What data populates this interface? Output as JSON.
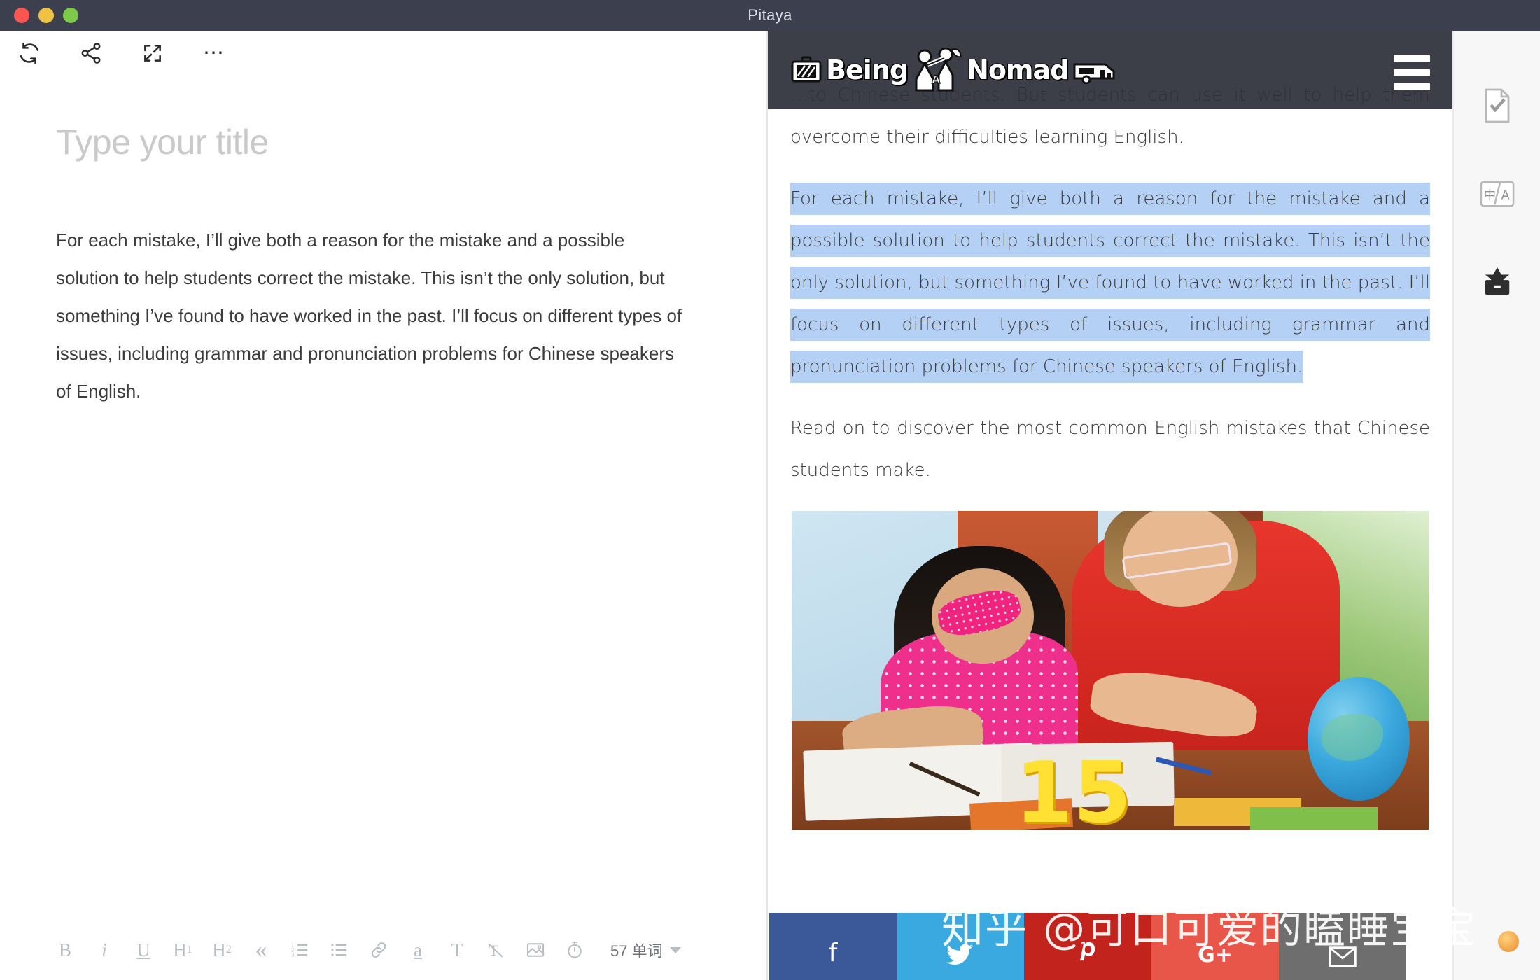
{
  "window": {
    "title": "Pitaya",
    "traffic_lights": [
      "close-red",
      "minimize-yellow",
      "zoom-green"
    ]
  },
  "editor": {
    "toolbar": [
      {
        "name": "sync-icon",
        "label": "Sync"
      },
      {
        "name": "share-icon",
        "label": "Share"
      },
      {
        "name": "fullscreen-icon",
        "label": "Fullscreen"
      },
      {
        "name": "more-options-icon",
        "label": "..."
      }
    ],
    "title_placeholder": "Type your title",
    "body_text": "For each mistake, I’ll give both a reason for the mistake and a possible solution to help students correct the mistake. This isn’t the only solution, but something I’ve found to have worked in the past. I’ll focus on different types of issues, including grammar and pronunciation problems for Chinese speakers of English."
  },
  "format_toolbar": {
    "bold": "B",
    "italic": "i",
    "underline": "U",
    "heading1": "H",
    "heading1_sub": "1",
    "heading2": "H",
    "heading2_sub": "2",
    "blockquote": "«",
    "ordered_list": "ordered-list-icon",
    "unordered_list": "unordered-list-icon",
    "link": "link-icon",
    "strikethrough": "a",
    "text_style": "T",
    "clear_format": "clear-format-icon",
    "image": "image-icon",
    "timer": "timer-icon",
    "word_count": "57 单词"
  },
  "preview": {
    "site_logo_text": "Being",
    "site_logo_text2": "Nomad",
    "site_logo_mid": "A",
    "menu_icon": "hamburger-menu-icon",
    "paragraphs": [
      {
        "id": "p-top",
        "text": "…to Chinese students. But students can use it well to help them overcome their difficulties learning English.",
        "selected": false
      },
      {
        "id": "p-selected",
        "text": "For each mistake, I’ll give both a reason for the mistake and a possible solution to help students correct the mistake. This isn’t the only solution, but something I’ve found to have worked in the past. I’ll focus on different types of issues, including grammar and pronunciation problems for Chinese speakers of English.",
        "selected": true
      },
      {
        "id": "p-read-on",
        "text": "Read on to discover the most common English mistakes that Chinese students make.",
        "selected": false
      }
    ],
    "image_overlay_number": "15",
    "social_buttons": [
      {
        "name": "facebook-share-button",
        "glyph": "f",
        "color": "#3b5998"
      },
      {
        "name": "twitter-share-button",
        "glyph": "ᵥ",
        "color": "#3aa9e0"
      },
      {
        "name": "pinterest-share-button",
        "glyph": "ᴘ",
        "color": "#c2231d"
      },
      {
        "name": "googleplus-share-button",
        "glyph": "G+",
        "color": "#e8564a"
      },
      {
        "name": "email-share-button",
        "glyph": "✉",
        "color": "#6e6e6e"
      }
    ]
  },
  "watermark": {
    "text": "知乎 @可口可爱的瞌睡宝宝"
  },
  "right_rail": {
    "items": [
      {
        "name": "proofread-check-icon",
        "label": "Proofread"
      },
      {
        "name": "translate-icon",
        "label": "中/A"
      },
      {
        "name": "archive-box-icon",
        "label": "Archive"
      }
    ]
  },
  "colors": {
    "titlebar": "#3b3f4e",
    "selection": "#b5d0f5",
    "site_header": "rgba(46,48,58,.93)",
    "rail_bg": "#f7f7f7"
  }
}
